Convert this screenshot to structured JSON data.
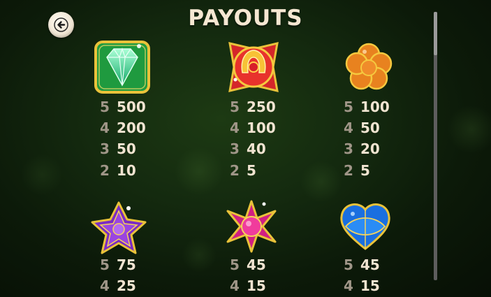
{
  "title": "PAYOUTS",
  "icons": {
    "back": "back-arrow-icon"
  },
  "symbols": [
    {
      "name": "green-diamond-gem-icon",
      "color": "#2fd68a",
      "payouts": [
        {
          "count": "5",
          "value": "500"
        },
        {
          "count": "4",
          "value": "200"
        },
        {
          "count": "3",
          "value": "50"
        },
        {
          "count": "2",
          "value": "10"
        }
      ]
    },
    {
      "name": "red-horseshoe-gem-icon",
      "color": "#e5332a",
      "payouts": [
        {
          "count": "5",
          "value": "250"
        },
        {
          "count": "4",
          "value": "100"
        },
        {
          "count": "3",
          "value": "40"
        },
        {
          "count": "2",
          "value": "5"
        }
      ]
    },
    {
      "name": "orange-flower-gem-icon",
      "color": "#e57b22",
      "payouts": [
        {
          "count": "5",
          "value": "100"
        },
        {
          "count": "4",
          "value": "50"
        },
        {
          "count": "3",
          "value": "20"
        },
        {
          "count": "2",
          "value": "5"
        }
      ]
    },
    {
      "name": "purple-star-gem-icon",
      "color": "#8a2fd1",
      "payouts": [
        {
          "count": "5",
          "value": "75"
        },
        {
          "count": "4",
          "value": "25"
        }
      ]
    },
    {
      "name": "pink-star-gem-icon",
      "color": "#e0278c",
      "payouts": [
        {
          "count": "5",
          "value": "45"
        },
        {
          "count": "4",
          "value": "15"
        }
      ]
    },
    {
      "name": "blue-heart-gem-icon",
      "color": "#1f7fe6",
      "payouts": [
        {
          "count": "5",
          "value": "45"
        },
        {
          "count": "4",
          "value": "15"
        }
      ]
    }
  ]
}
